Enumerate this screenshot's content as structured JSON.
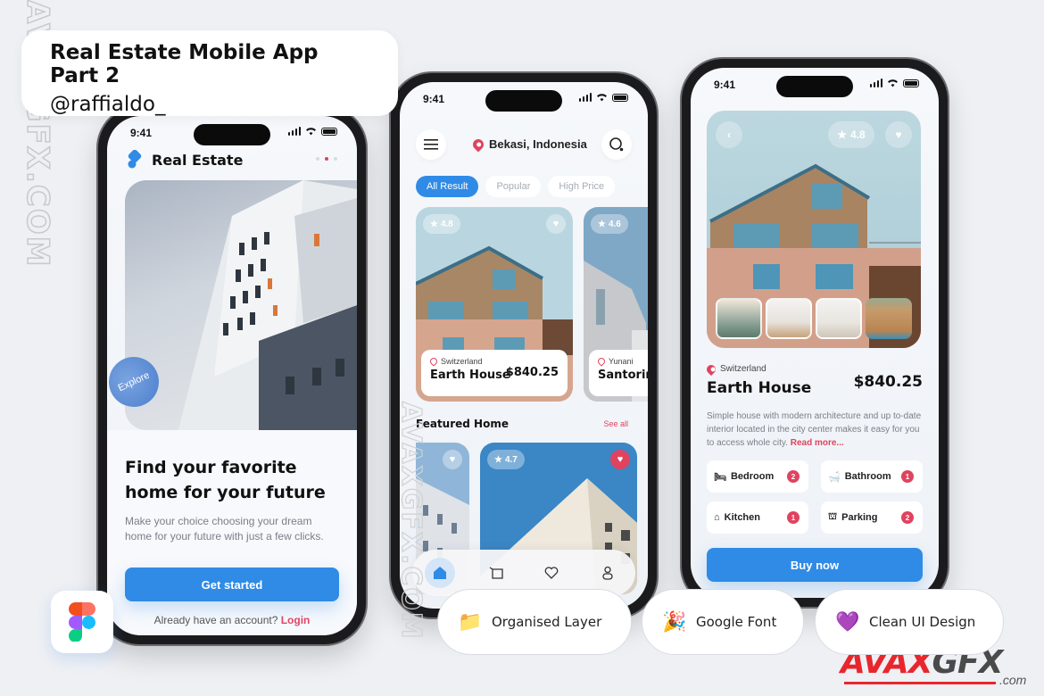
{
  "header": {
    "title": "Real Estate Mobile App Part 2",
    "author": "@raffialdo_"
  },
  "watermark": {
    "side_text": "AVAXGFX.COM",
    "brand_main_a": "AVAX",
    "brand_main_b": "GFX",
    "brand_sub": ".com",
    "brand_color": "#e8262c"
  },
  "status_bar": {
    "time": "9:41"
  },
  "onboarding": {
    "logo_label": "Real Estate",
    "explore_badge": "Explore",
    "headline_line1": "Find your favorite",
    "headline_line2": "home for your future",
    "subtitle": "Make your choice choosing your dream home for your future with just a few clicks.",
    "cta_label": "Get started",
    "account_prompt": "Already have an account?",
    "login_label": "Login",
    "page_indicator": {
      "count": 3,
      "active_index": 1
    }
  },
  "home": {
    "location": "Bekasi, Indonesia",
    "filters": [
      {
        "label": "All Result",
        "active": true
      },
      {
        "label": "Popular",
        "active": false
      },
      {
        "label": "High Price",
        "active": false
      }
    ],
    "listings": [
      {
        "rating": "4.8",
        "country": "Switzerland",
        "name": "Earth House",
        "price": "$840.25",
        "liked": false
      },
      {
        "rating": "4.6",
        "country": "Yunani",
        "name": "Santorini",
        "price": "",
        "liked": false
      }
    ],
    "featured_title": "Featured Home",
    "see_all_label": "See all",
    "featured": [
      {
        "rating": "",
        "liked": false
      },
      {
        "rating": "4.7",
        "liked": true
      }
    ],
    "tabs": [
      {
        "icon": "home-icon",
        "active": true
      },
      {
        "icon": "cart-icon",
        "active": false
      },
      {
        "icon": "heart-icon",
        "active": false
      },
      {
        "icon": "profile-icon",
        "active": false
      }
    ]
  },
  "detail": {
    "rating": "4.8",
    "country": "Switzerland",
    "name": "Earth House",
    "price": "$840.25",
    "description": "Simple house with modern architecture and up to-date interior located in the city center makes it easy for you to access whole city.",
    "read_more": "Read more...",
    "features": [
      {
        "icon": "bed-icon",
        "label": "Bedroom",
        "count": "2"
      },
      {
        "icon": "bath-icon",
        "label": "Bathroom",
        "count": "1"
      },
      {
        "icon": "kitchen-icon",
        "label": "Kitchen",
        "count": "1"
      },
      {
        "icon": "parking-icon",
        "label": "Parking",
        "count": "2"
      }
    ],
    "cta_label": "Buy now"
  },
  "feature_pills": [
    {
      "emoji": "📁",
      "label": "Organised Layer"
    },
    {
      "emoji": "🎉",
      "label": "Google Font"
    },
    {
      "emoji": "💜",
      "label": "Clean UI Design"
    }
  ],
  "colors": {
    "primary": "#2f8be6",
    "accent": "#e0435f",
    "background": "#eef0f4"
  }
}
